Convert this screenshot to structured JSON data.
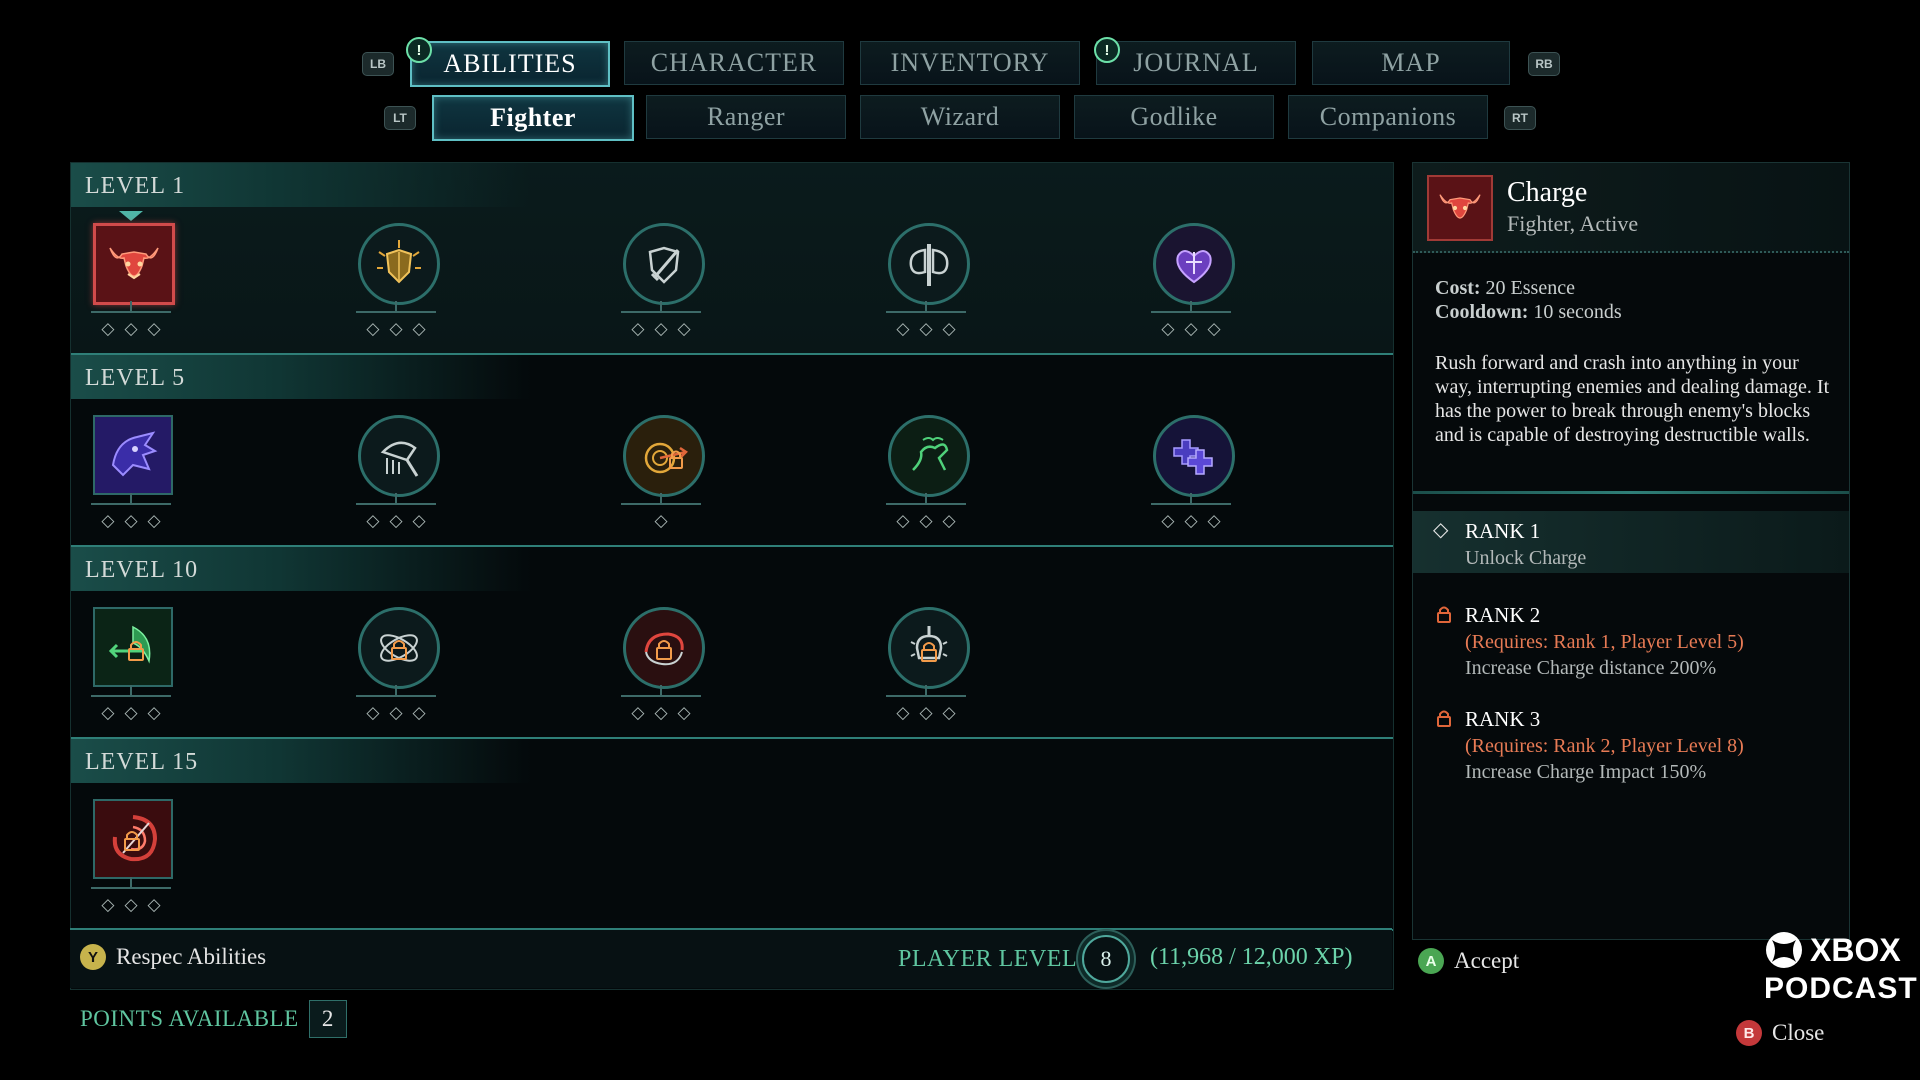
{
  "nav": {
    "lb": "LB",
    "rb": "RB",
    "lt": "LT",
    "rt": "RT",
    "tabs": [
      {
        "label": "ABILITIES",
        "alert": "!"
      },
      {
        "label": "CHARACTER"
      },
      {
        "label": "INVENTORY"
      },
      {
        "label": "JOURNAL",
        "alert": "!"
      },
      {
        "label": "MAP"
      }
    ],
    "subtabs": [
      "Fighter",
      "Ranger",
      "Wizard",
      "Godlike",
      "Companions"
    ]
  },
  "tree": {
    "levels": [
      {
        "label": "LEVEL 1",
        "abilities": [
          "charge-icon",
          "shield-sun-icon",
          "shield-sword-icon",
          "battle-axe-icon",
          "heart-shield-icon"
        ]
      },
      {
        "label": "LEVEL 5",
        "abilities": [
          "rage-face-icon",
          "axe-strike-icon",
          "target-arrow-icon",
          "vine-leap-icon",
          "cross-stack-icon"
        ]
      },
      {
        "label": "LEVEL 10",
        "abilities": [
          "arrow-burst-icon",
          "spin-orbit-icon",
          "whirl-slash-icon",
          "skull-blade-icon"
        ]
      },
      {
        "label": "LEVEL 15",
        "abilities": [
          "vortex-slash-icon"
        ]
      }
    ],
    "pips": "◇◇◇",
    "pip_single": "◇"
  },
  "bottom": {
    "respec_button": "Y",
    "respec_label": "Respec Abilities",
    "player_level_label": "PLAYER LEVEL",
    "player_level": "8",
    "xp": "(11,968 / 12,000 XP)",
    "points_label": "POINTS AVAILABLE",
    "points_value": "2"
  },
  "detail": {
    "name": "Charge",
    "type": "Fighter, Active",
    "cost_label": "Cost:",
    "cost_value": "20 Essence",
    "cooldown_label": "Cooldown:",
    "cooldown_value": "10 seconds",
    "description": "Rush forward and crash into anything in your way, interrupting enemies and dealing damage. It has the power to break through enemy's blocks and is capable of destroying destructible walls.",
    "ranks": [
      {
        "title": "RANK 1",
        "requires": "",
        "effect": "Unlock Charge"
      },
      {
        "title": "RANK 2",
        "requires": "(Requires: Rank 1, Player Level 5)",
        "effect": "Increase Charge distance 200%"
      },
      {
        "title": "RANK 3",
        "requires": "(Requires: Rank 2, Player Level 8)",
        "effect": "Increase Charge Impact 150%"
      }
    ]
  },
  "actions": {
    "accept_button": "A",
    "accept_label": "Accept",
    "close_button": "B",
    "close_label": "Close"
  },
  "watermark": {
    "line1": "XBOX",
    "line2": "PODCAST"
  },
  "colors": {
    "accent": "#5fbfc4",
    "lock": "#e0663a",
    "requires": "#e87b55"
  }
}
